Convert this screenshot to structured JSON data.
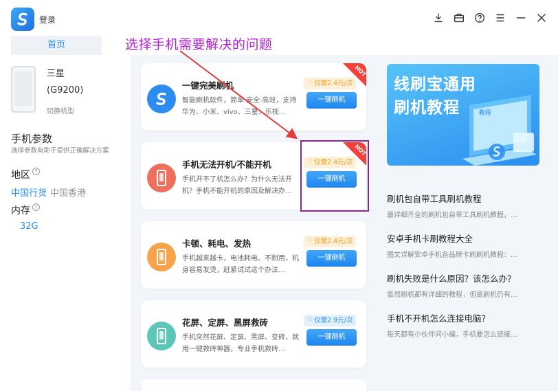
{
  "titlebar": {
    "login_label": "登录",
    "home_tab": "首页"
  },
  "annotation": {
    "text": "选择手机需要解决的问题",
    "color": "#b21fd6"
  },
  "phone": {
    "brand": "三星",
    "model": "(G9200)",
    "switch_label": "切换机型"
  },
  "params": {
    "title": "手机参数",
    "subtitle": "选择参数有助于提供正确解决方案",
    "region_label": "地区",
    "region_options": [
      "中国行货",
      "中国香港"
    ],
    "storage_label": "内存",
    "storage_value": "32G",
    "help_glyph": "?"
  },
  "cards": [
    {
      "title": "一键完美刷机",
      "desc": "智能刷机软件，简单·安全·高效，支持华为、小米、vivo、三星、乐视…",
      "price": "仅需2.4元/次",
      "button": "一键刷机",
      "hot": "HOT",
      "icon": "logo-icon",
      "icon_color": "#2d8cf0"
    },
    {
      "title": "手机无法开机/不能开机",
      "desc": "手机开不了机怎么办？为什么无法开机？手机不能开机的原因及解决办…",
      "price": "仅需2.4元/次",
      "button": "一键刷机",
      "hot": "HOT",
      "icon": "phone-icon",
      "icon_color": "#ee6f5c"
    },
    {
      "title": "卡顿、耗电、发热",
      "desc": "手机越来越卡，电池耗电、不耐用，机身容易发烫，赶紧试试这个办法…",
      "price": "仅需2.4元/次",
      "button": "一键刷机",
      "icon": "phone-icon",
      "icon_color": "#f5a44a"
    },
    {
      "title": "花屏、定屏、黑屏救砖",
      "desc": "手机突然花屏、定屏、黑屏、变砖，就用一键救砖神器，专业手机救砖…",
      "price": "仅需2.9元/次",
      "button": "一键刷机",
      "icon": "phone-icon",
      "icon_color": "#5cc6b8"
    }
  ],
  "banner": {
    "line1": "线刷宝通用",
    "line2": "刷机教程",
    "screen_label": "教程"
  },
  "articles": [
    {
      "title": "刷机包自带工具刷机教程",
      "desc": "最详细齐全的刷机包自带工具刷机教程，…"
    },
    {
      "title": "安卓手机卡刷教程大全",
      "desc": "图文详解安卓手机各品牌卡刷刷机教程：…"
    },
    {
      "title": "刷机失败是什么原因？该怎么办？",
      "desc": "虽然刷机都有详细的教程，但是刷机仍有…"
    },
    {
      "title": "手机不开机怎么连接电脑？",
      "desc": "每天都有小伙伴问小编，手机要怎么链接…"
    }
  ],
  "colors": {
    "accent": "#2d8cf0",
    "hot": "#f2413a",
    "highlight_box": "#8b2a86",
    "arrow": "#e23c3c"
  }
}
